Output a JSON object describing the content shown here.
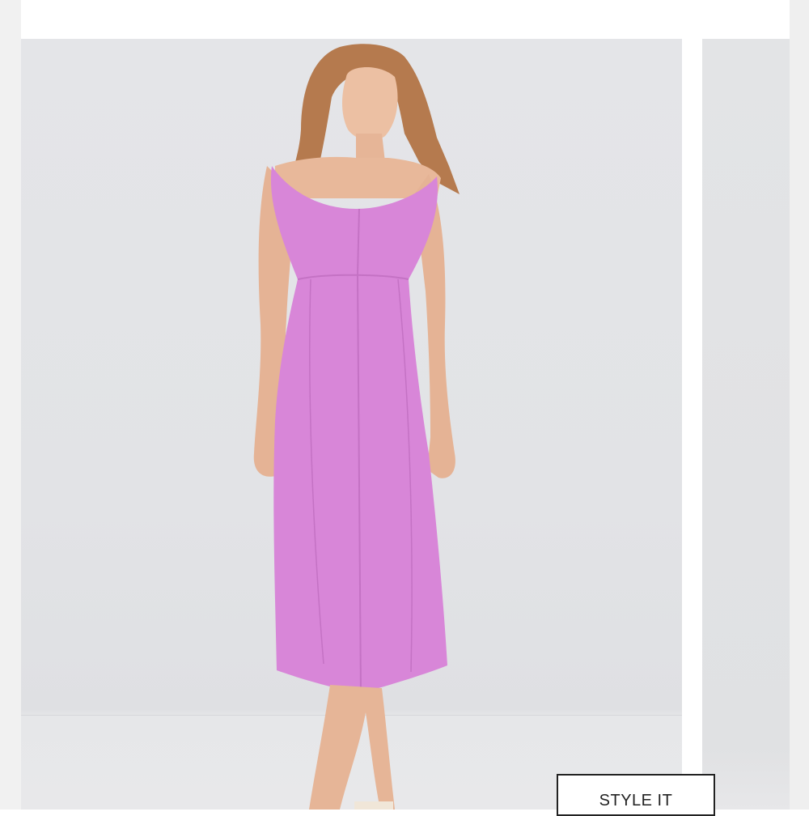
{
  "gallery": {
    "main_image": {
      "icon": "product-photo-icon",
      "subject": "pink-midi-dress"
    },
    "next_image": {
      "icon": "product-photo-icon"
    }
  },
  "actions": {
    "style_it_label": "STYLE IT"
  },
  "colors": {
    "dress": "#d886d8",
    "background": "#e3e4e7",
    "button_border": "#222222"
  }
}
